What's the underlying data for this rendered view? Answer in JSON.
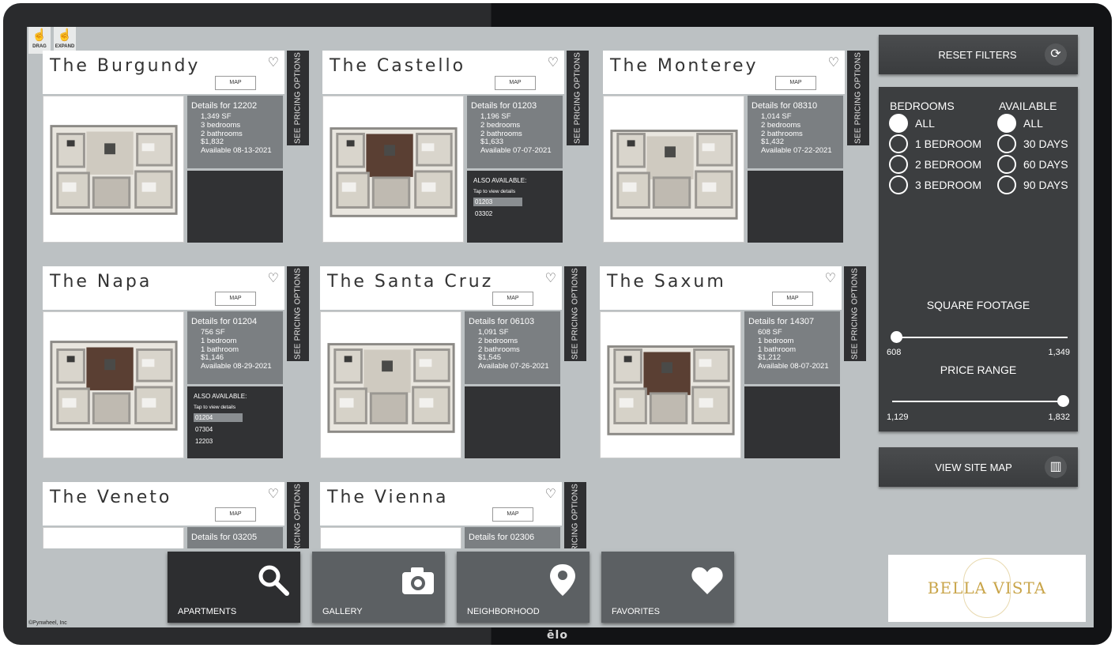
{
  "brand": "ēlo",
  "toolbar": {
    "drag_label": "DRAG",
    "expand_label": "EXPAND"
  },
  "copyright": "©Pynwheel, Inc",
  "labels": {
    "map": "MAP",
    "pricing": "SEE PRICING OPTIONS",
    "also": "ALSO AVAILABLE:",
    "tap": "Tap to view details"
  },
  "cards": [
    {
      "name": "The Burgundy",
      "details_title": "Details for 12202",
      "lines": [
        "1,349 SF",
        "3 bedrooms",
        "2 bathrooms",
        "$1,832",
        "Available  08-13-2021"
      ],
      "also": []
    },
    {
      "name": "The Castello",
      "details_title": "Details for 01203",
      "lines": [
        "1,196 SF",
        "2 bedrooms",
        "2 bathrooms",
        "$1,633",
        "Available  07-07-2021"
      ],
      "also": [
        "01203",
        "03302"
      ]
    },
    {
      "name": "The Monterey",
      "details_title": "Details for 08310",
      "lines": [
        "1,014 SF",
        "2 bedrooms",
        "2 bathrooms",
        "$1,432",
        "Available  07-22-2021"
      ],
      "also": []
    },
    {
      "name": "The Napa",
      "details_title": "Details for 01204",
      "lines": [
        "756 SF",
        "1 bedroom",
        "1 bathroom",
        "$1,146",
        "Available  08-29-2021"
      ],
      "also": [
        "01204",
        "07304",
        "12203"
      ]
    },
    {
      "name": "The Santa Cruz",
      "details_title": "Details for 06103",
      "lines": [
        "1,091 SF",
        "2 bedrooms",
        "2 bathrooms",
        "$1,545",
        "Available  07-26-2021"
      ],
      "also": []
    },
    {
      "name": "The Saxum",
      "details_title": "Details for 14307",
      "lines": [
        "608 SF",
        "1 bedroom",
        "1 bathroom",
        "$1,212",
        "Available  08-07-2021"
      ],
      "also": []
    },
    {
      "name": "The Veneto",
      "details_title": "Details for 03205",
      "lines": [],
      "also": []
    },
    {
      "name": "The Vienna",
      "details_title": "Details for 02306",
      "lines": [],
      "also": []
    }
  ],
  "filters": {
    "reset_label": "RESET FILTERS",
    "reset_icon": "refresh-icon",
    "bedrooms_title": "BEDROOMS",
    "bedrooms": [
      "ALL",
      "1 BEDROOM",
      "2 BEDROOM",
      "3 BEDROOM"
    ],
    "bedrooms_selected": "ALL",
    "available_title": "AVAILABLE",
    "available": [
      "ALL",
      "30 DAYS",
      "60 DAYS",
      "90 DAYS"
    ],
    "available_selected": "ALL",
    "sqft_title": "SQUARE FOOTAGE",
    "sqft_min": "608",
    "sqft_max": "1,349",
    "price_title": "PRICE RANGE",
    "price_min": "1,129",
    "price_max": "1,832",
    "site_map_label": "VIEW SITE MAP",
    "site_map_icon": "map-icon"
  },
  "logo": {
    "text": "BELLA VISTA"
  },
  "nav": [
    {
      "label": "APARTMENTS",
      "icon": "search-icon",
      "active": true
    },
    {
      "label": "GALLERY",
      "icon": "camera-icon",
      "active": false
    },
    {
      "label": "NEIGHBORHOOD",
      "icon": "location-pin-icon",
      "active": false
    },
    {
      "label": "FAVORITES",
      "icon": "heart-icon",
      "active": false
    }
  ],
  "colors": {
    "screen_bg": "#bcc1c3",
    "panel_dark": "#3c3e40",
    "detail_gray": "#7b7f82",
    "accent_gold": "#c9a54a"
  }
}
